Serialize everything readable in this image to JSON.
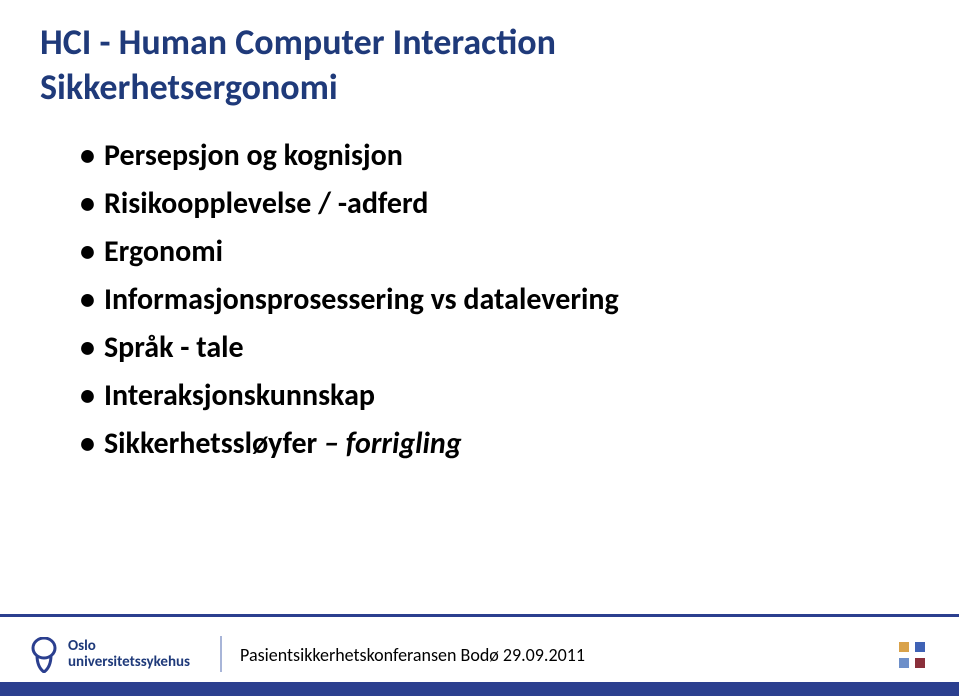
{
  "title_line1": "HCI - Human Computer Interaction",
  "title_line2": "Sikkerhetsergonomi",
  "bullets": {
    "b0": "Persepsjon og kognisjon",
    "b1": "Risikoopplevelse / -adferd",
    "b2": "Ergonomi",
    "b3": "Informasjonsprosessering vs datalevering",
    "b4": "Språk - tale",
    "b5": "Interaksjonskunnskap",
    "b6_prefix": "Sikkerhetssløyfer ",
    "b6_italic": "– forrigling"
  },
  "logo": {
    "line1": "Oslo",
    "line2": "universitetssykehus"
  },
  "footer_text": "Pasientsikkerhetskonferansen Bodø 29.09.2011"
}
